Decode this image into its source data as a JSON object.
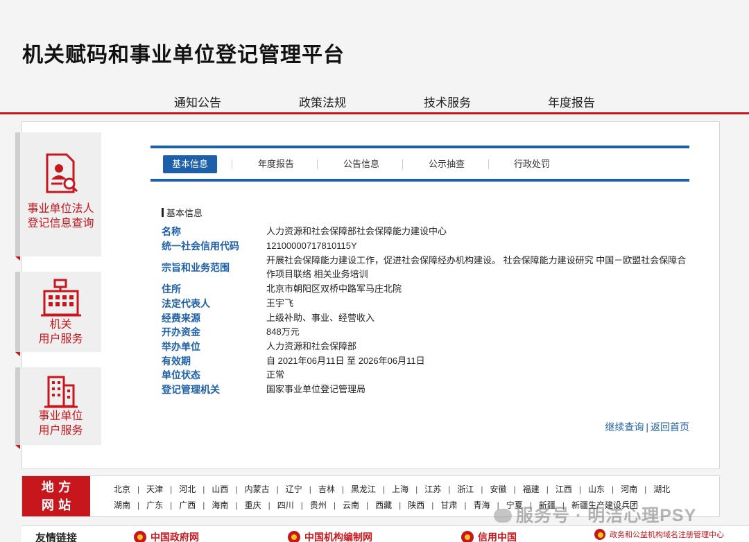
{
  "header": {
    "title": "机关赋码和事业单位登记管理平台",
    "nav": [
      "通知公告",
      "政策法规",
      "技术服务",
      "年度报告"
    ]
  },
  "sidebar": {
    "tiles": [
      {
        "line1": "事业单位法人",
        "line2": "登记信息查询",
        "icon": "document-search-icon"
      },
      {
        "line1": "机关",
        "line2": "用户服务",
        "icon": "government-building-icon"
      },
      {
        "line1": "事业单位",
        "line2": "用户服务",
        "icon": "office-building-icon"
      }
    ]
  },
  "tabs": [
    "基本信息",
    "年度报告",
    "公告信息",
    "公示抽查",
    "行政处罚"
  ],
  "info": {
    "section_title": "基本信息",
    "rows": [
      {
        "label": "名称",
        "value": "人力资源和社会保障部社会保障能力建设中心"
      },
      {
        "label": "统一社会信用代码",
        "value": "12100000717810115Y"
      },
      {
        "label": "宗旨和业务范围",
        "value": "开展社会保障能力建设工作，促进社会保障经办机构建设。 社会保障能力建设研究 中国－欧盟社会保障合作项目联络 相关业务培训"
      },
      {
        "label": "住所",
        "value": "北京市朝阳区双桥中路军马庄北院"
      },
      {
        "label": "法定代表人",
        "value": "王宇飞"
      },
      {
        "label": "经费来源",
        "value": "上级补助、事业、经营收入"
      },
      {
        "label": "开办资金",
        "value": "848万元"
      },
      {
        "label": "举办单位",
        "value": "人力资源和社会保障部"
      },
      {
        "label": "有效期",
        "value": "自 2021年06月11日 至 2026年06月11日"
      },
      {
        "label": "单位状态",
        "value": "正常"
      },
      {
        "label": "登记管理机关",
        "value": "国家事业单位登记管理局"
      }
    ]
  },
  "links": {
    "continue": "继续查询",
    "separator": "|",
    "home": "返回首页"
  },
  "regions": {
    "title_line1": "地 方",
    "title_line2": "网 站",
    "row1": [
      "北京",
      "天津",
      "河北",
      "山西",
      "内蒙古",
      "辽宁",
      "吉林",
      "黑龙江",
      "上海",
      "江苏",
      "浙江",
      "安徽",
      "福建",
      "江西",
      "山东",
      "河南",
      "湖北"
    ],
    "row2": [
      "湖南",
      "广东",
      "广西",
      "海南",
      "重庆",
      "四川",
      "贵州",
      "云南",
      "西藏",
      "陕西",
      "甘肃",
      "青海",
      "宁夏",
      "新疆",
      "新疆生产建设兵团"
    ]
  },
  "friends": {
    "title": "友情链接",
    "items": [
      "中国政府网",
      "中国机构编制网",
      "信用中国"
    ],
    "small": "政务和公益机构域名注册管理中心"
  },
  "watermark": "服务号 · 明洁心理PSY",
  "colors": {
    "brand_red": "#c8161d",
    "brand_blue": "#1d5fa8"
  }
}
